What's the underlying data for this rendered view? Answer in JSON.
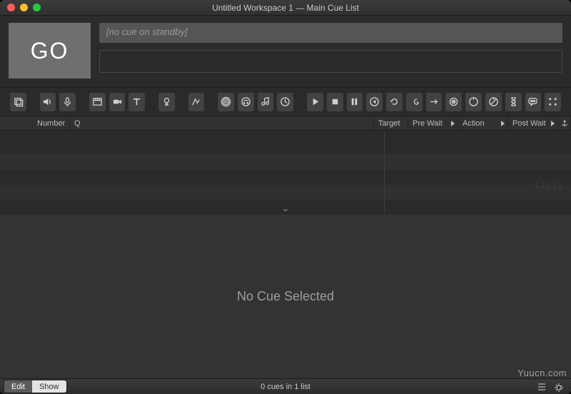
{
  "window": {
    "title": "Untitled Workspace 1 — Main Cue List"
  },
  "go": {
    "label": "GO"
  },
  "standby": {
    "text": "[no cue on standby]"
  },
  "columns": {
    "number": "Number",
    "q": "Q",
    "target": "Target",
    "prewait": "Pre Wait",
    "action": "Action",
    "postwait": "Post Wait"
  },
  "inspector": {
    "empty": "No Cue Selected"
  },
  "footer": {
    "edit": "Edit",
    "show": "Show",
    "status": "0 cues in 1 list"
  },
  "watermark": "Yuucn.com",
  "toolbar": {
    "group": "Group",
    "audio": "Audio",
    "mic": "Mic",
    "video": "Video",
    "camera": "Camera",
    "text": "Text",
    "light": "Light",
    "fade": "Fade",
    "network": "Network",
    "midi": "MIDI",
    "midifile": "MIDI File",
    "timecode": "Timecode",
    "start": "Start",
    "stop": "Stop",
    "pause": "Pause",
    "load": "Load",
    "reset": "Reset",
    "devamp": "Devamp",
    "goto": "GoTo",
    "target": "Target",
    "arm": "Arm",
    "disarm": "Disarm",
    "wait": "Wait",
    "memo": "Memo",
    "script": "Script"
  }
}
